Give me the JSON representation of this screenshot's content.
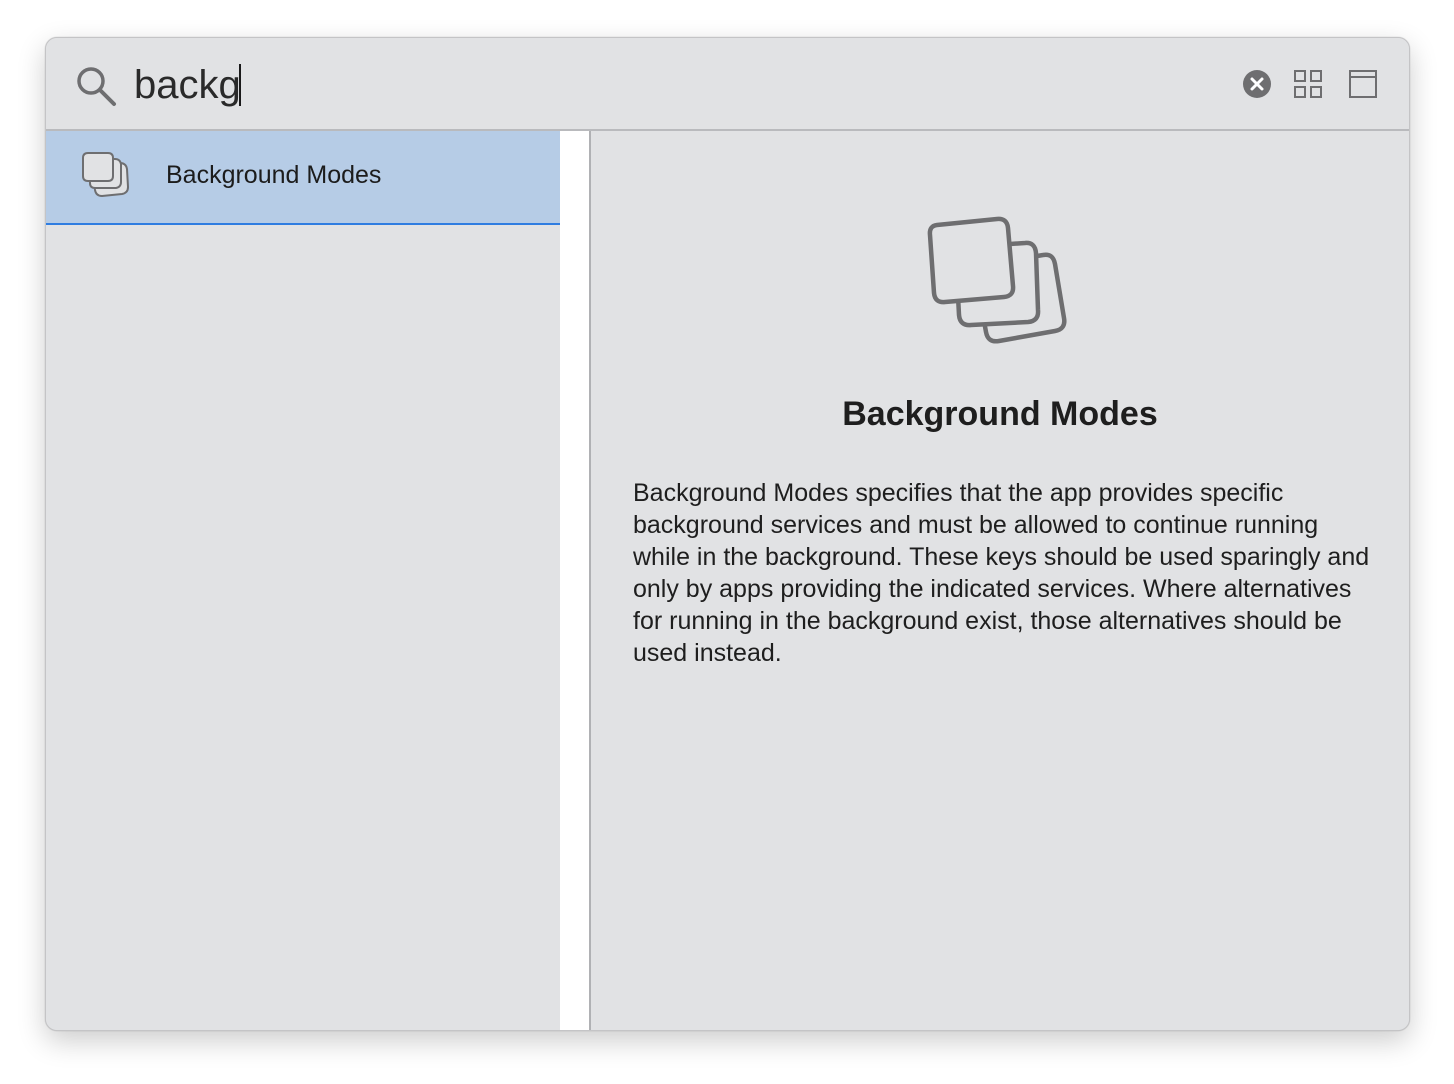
{
  "search": {
    "value": "backg",
    "icons": {
      "search": "magnifying-glass-icon",
      "clear": "clear-circle-x-icon",
      "grid": "grid-view-icon",
      "panel": "panel-view-icon"
    }
  },
  "results": [
    {
      "label": "Background Modes",
      "icon": "stacked-squares-icon",
      "selected": true
    }
  ],
  "detail": {
    "icon": "stacked-squares-icon",
    "title": "Background Modes",
    "description": "Background Modes specifies that the app provides specific background services and must be allowed to continue running while in the background. These keys should be used sparingly and only by apps providing the indicated services. Where alternatives for running in the background exist, those alternatives should be used instead."
  },
  "colors": {
    "window_background": "#e1e2e4",
    "selection_background": "#b6cce6",
    "selection_underline": "#2f7de1",
    "icon_gray": "#6e6e70"
  }
}
